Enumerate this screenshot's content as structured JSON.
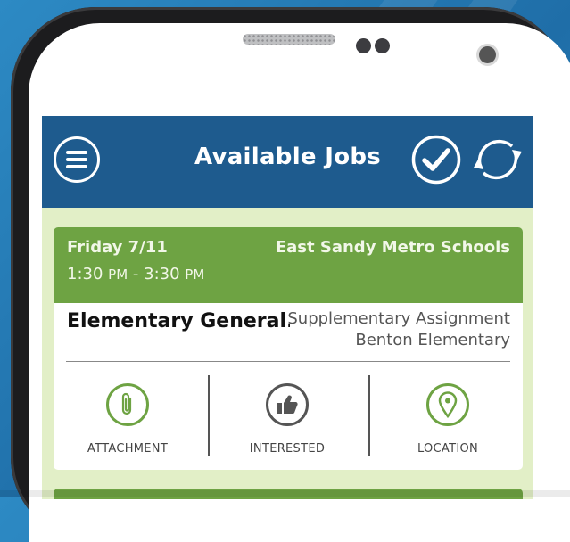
{
  "appbar": {
    "title": "Available Jobs",
    "menu_icon": "hamburger-menu-icon",
    "accept_icon": "checkmark-circle-icon",
    "refresh_icon": "refresh-icon"
  },
  "job": {
    "date": "Friday 7/11",
    "district": "East Sandy Metro Schools",
    "time_start": "1:30",
    "time_start_ampm": "PM",
    "time_separator": "-",
    "time_end": "3:30",
    "time_end_ampm": "PM",
    "title": "Elementary General...",
    "assignment": "Supplementary Assignment",
    "school": "Benton Elementary"
  },
  "actions": [
    {
      "label": "ATTACHMENT",
      "icon": "paperclip-icon",
      "color": "#6ea343"
    },
    {
      "label": "INTERESTED",
      "icon": "thumbs-up-icon",
      "color": "#555555"
    },
    {
      "label": "LOCATION",
      "icon": "map-pin-icon",
      "color": "#6ea343"
    }
  ],
  "colors": {
    "appbar": "#1e5b8e",
    "card_header": "#6ea343",
    "screen_bg": "#e2efc7",
    "backdrop": "#2d8ac4"
  }
}
